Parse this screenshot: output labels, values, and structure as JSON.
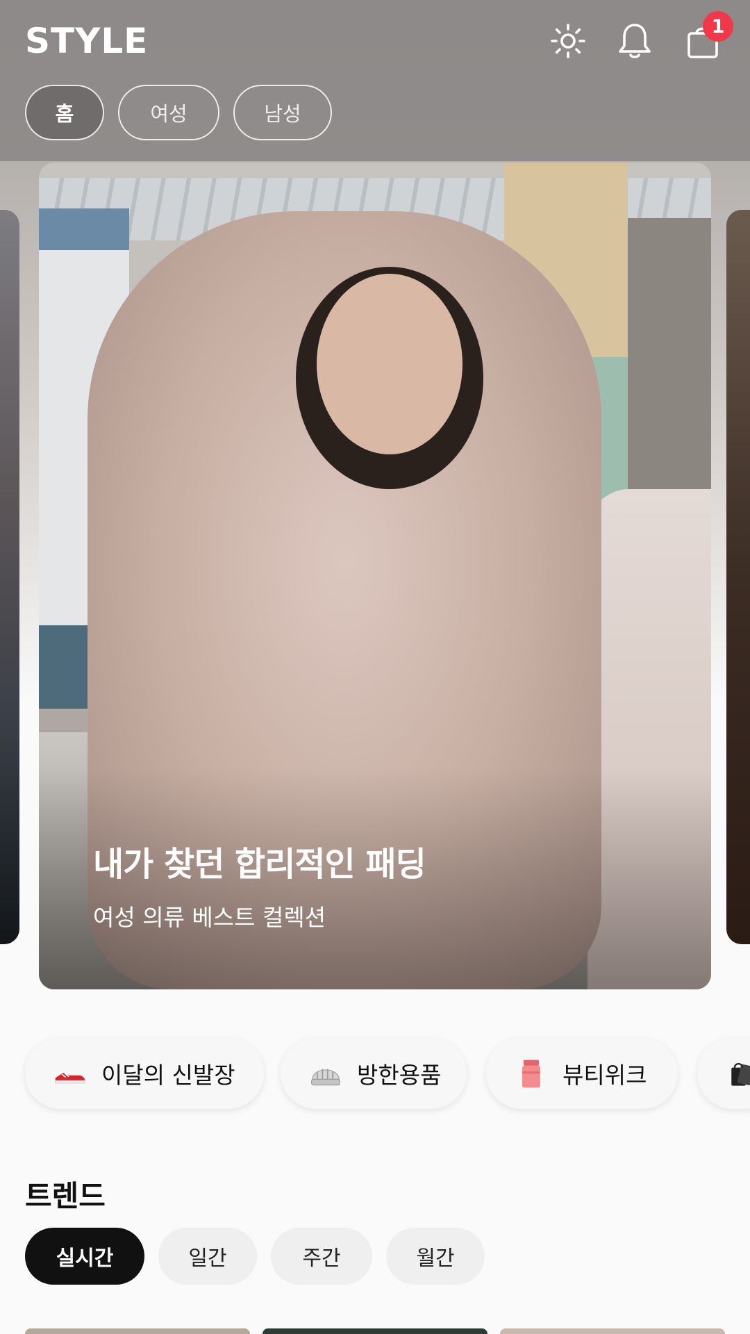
{
  "header": {
    "logo": "STYLE",
    "icons": [
      "sun-icon",
      "bell-icon",
      "shopping-bag-icon"
    ],
    "cart_count": "1",
    "tabs": [
      {
        "label": "홈",
        "active": true
      },
      {
        "label": "여성",
        "active": false
      },
      {
        "label": "남성",
        "active": false
      }
    ]
  },
  "hero": {
    "title": "내가 찾던 합리적인 패딩",
    "subtitle": "여성 의류 베스트 컬렉션"
  },
  "categories": [
    {
      "label": "이달의 신발장",
      "icon": "sneaker-icon"
    },
    {
      "label": "방한용품",
      "icon": "knit-hat-icon"
    },
    {
      "label": "뷰티위크",
      "icon": "cosmetic-jar-icon"
    },
    {
      "label": "",
      "icon": "shopping-bags-icon"
    }
  ],
  "trend": {
    "title": "트렌드",
    "tabs": [
      {
        "label": "실시간",
        "active": true
      },
      {
        "label": "일간",
        "active": false
      },
      {
        "label": "주간",
        "active": false
      },
      {
        "label": "월간",
        "active": false
      }
    ]
  },
  "colors": {
    "badge": "#f0384a",
    "active_tab": "#111111",
    "chip_bg": "#f7f7f7"
  }
}
